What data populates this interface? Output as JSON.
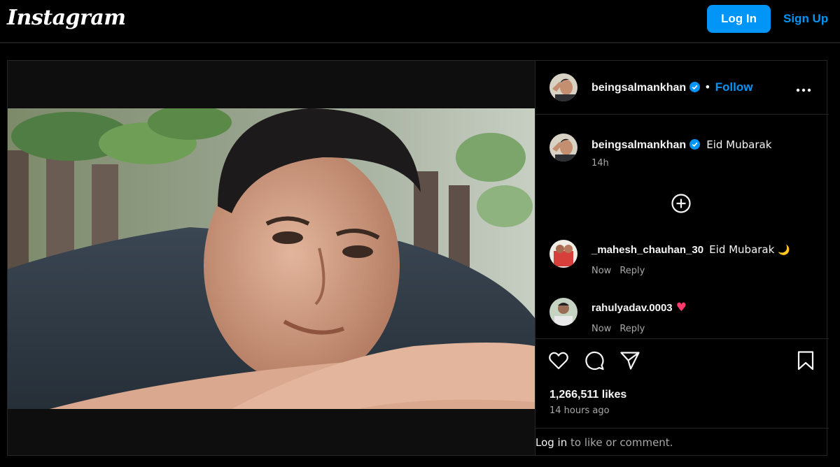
{
  "header": {
    "logo": "Instagram",
    "login_label": "Log In",
    "signup_label": "Sign Up"
  },
  "post": {
    "author": {
      "username": "beingsalmankhan",
      "verified": true,
      "follow_label": "Follow",
      "separator": "•"
    },
    "caption": {
      "username": "beingsalmankhan",
      "text": "Eid Mubarak",
      "time": "14h"
    },
    "comments": [
      {
        "username": "_mahesh_chauhan_30",
        "text": "Eid Mubarak",
        "emoji": "🌙",
        "time": "Now",
        "reply_label": "Reply"
      },
      {
        "username": "rahulyadav.0003",
        "text": "",
        "emoji": "♥",
        "time": "Now",
        "reply_label": "Reply"
      }
    ],
    "likes": "1,266,511 likes",
    "posted": "14 hours ago",
    "login_prompt": {
      "link": "Log in",
      "rest": " to like or comment."
    },
    "icons": [
      "heart-icon",
      "comment-icon",
      "share-icon",
      "bookmark-icon",
      "more-options-icon",
      "add-comment-icon",
      "verified-badge-icon"
    ]
  },
  "colors": {
    "accent": "#0095f6",
    "background": "#000000",
    "border": "#262626",
    "muted_text": "#a8a8a8",
    "heart_emoji": "#ff3b6b"
  }
}
